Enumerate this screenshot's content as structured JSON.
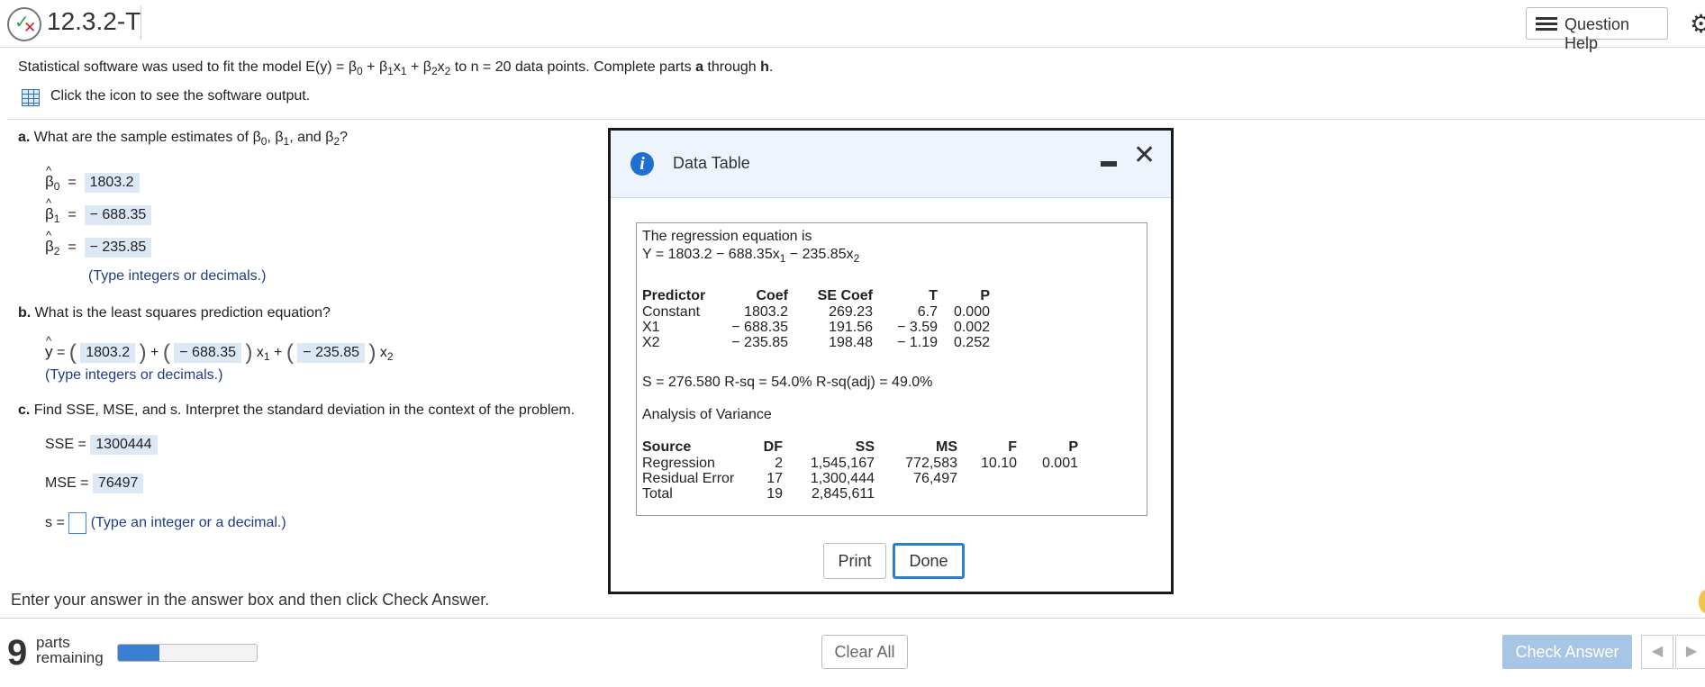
{
  "header": {
    "title": "12.3.2-T",
    "question_help": "Question Help"
  },
  "prompt": {
    "pre": "Statistical software was used to fit the model E(y) = β",
    "model_pieces": [
      "0",
      " + β",
      "1",
      "x",
      "1",
      " + β",
      "2",
      "x",
      "2"
    ],
    "post": " to n = 20 data points. Complete parts ",
    "bold_a": "a",
    "through": " through ",
    "bold_h": "h",
    "period": "."
  },
  "icon_link": "Click the icon to see the software output.",
  "part_a": {
    "label": "a.",
    "question": " What are the sample estimates of β",
    "sub0": "0",
    "comma1": ", β",
    "sub1": "1",
    "and": ", and β",
    "sub2": "2",
    "q": "?",
    "b0": "1803.2",
    "b1": "− 688.35",
    "b2": "− 235.85",
    "hint": "(Type integers or decimals.)"
  },
  "part_b": {
    "label": "b.",
    "question": " What is the least squares prediction equation?",
    "c0": "1803.2",
    "c1": "− 688.35",
    "c2": "− 235.85",
    "hint": "(Type integers or decimals.)"
  },
  "part_c": {
    "label": "c.",
    "question": " Find SSE, MSE, and s. Interpret the standard deviation in the context of the problem.",
    "sse_label": "SSE =",
    "sse": "1300444",
    "mse_label": "MSE =",
    "mse": "76497",
    "s_label": "s =",
    "s_value": "",
    "hint": "(Type an integer or a decimal.)"
  },
  "bottom_msg": "Enter your answer in the answer box and then click Check Answer.",
  "footer": {
    "parts_num": "9",
    "parts_line1": "parts",
    "parts_line2": "remaining",
    "progress": 0.3,
    "clear_all": "Clear All",
    "check_answer": "Check Answer"
  },
  "dialog": {
    "title": "Data Table",
    "eq_line1": "The regression equation is",
    "eq_line2_pre": "Y = 1803.2 − 688.35x",
    "eq_sub1": "1",
    "eq_mid": " − 235.85x",
    "eq_sub2": "2",
    "coef_headers": [
      "Predictor",
      "Coef",
      "SE Coef",
      "T",
      "P"
    ],
    "coef_rows": [
      [
        "Constant",
        "1803.2",
        "269.23",
        "6.7",
        "0.000"
      ],
      [
        "X1",
        "− 688.35",
        "191.56",
        "− 3.59",
        "0.002"
      ],
      [
        "X2",
        "− 235.85",
        "198.48",
        "− 1.19",
        "0.252"
      ]
    ],
    "fit_line": "S = 276.580   R-sq = 54.0%   R-sq(adj) = 49.0%",
    "anova_title": "Analysis of Variance",
    "anova_headers": [
      "Source",
      "DF",
      "SS",
      "MS",
      "F",
      "P"
    ],
    "anova_rows": [
      [
        "Regression",
        "2",
        "1,545,167",
        "772,583",
        "10.10",
        "0.001"
      ],
      [
        "Residual Error",
        "17",
        "1,300,444",
        "76,497",
        "",
        ""
      ],
      [
        "Total",
        "19",
        "2,845,611",
        "",
        "",
        ""
      ]
    ],
    "print": "Print",
    "done": "Done"
  },
  "colors": {
    "accent": "#2a7fd0",
    "answer_bg": "#dde8f5",
    "hint": "#1f3c8a",
    "check_btn": "#a7c6e6"
  }
}
